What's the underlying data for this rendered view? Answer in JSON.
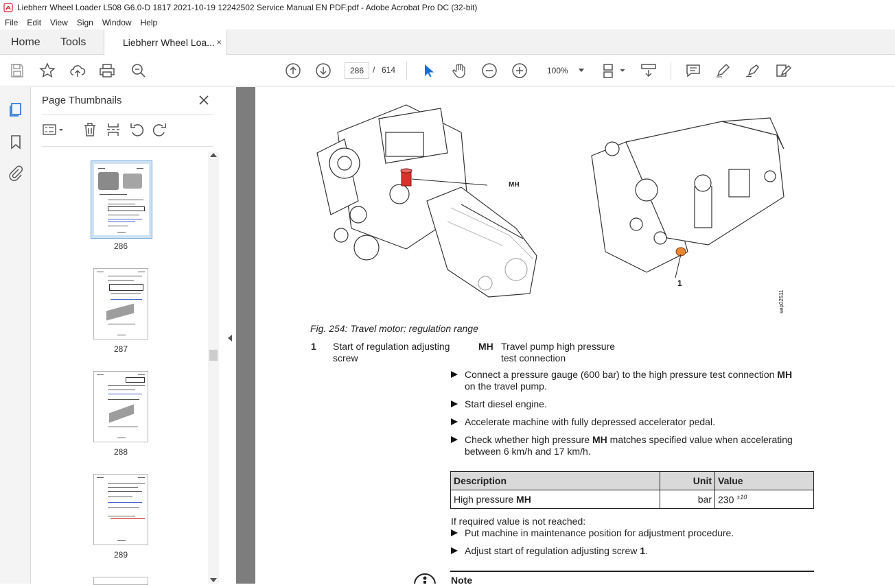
{
  "window": {
    "title": "Liebherr Wheel Loader L508 G6.0-D 1817 2021-10-19 12242502 Service Manual EN PDF.pdf - Adobe Acrobat Pro DC (32-bit)"
  },
  "menu": [
    "File",
    "Edit",
    "View",
    "Sign",
    "Window",
    "Help"
  ],
  "tabs": {
    "home": "Home",
    "tools": "Tools",
    "document": "Liebherr Wheel Loa...",
    "close": "×"
  },
  "toolbar": {
    "current_page": "286",
    "page_separator": "/",
    "page_count": "614",
    "zoom": "100%"
  },
  "thumbnails": {
    "title": "Page Thumbnails",
    "pages": [
      "286",
      "287",
      "288",
      "289"
    ],
    "selected_page": "286"
  },
  "document": {
    "callout_mh": "MH",
    "callout_1": "1",
    "figure_code": "sep02511",
    "caption": "Fig. 254: Travel motor: regulation range",
    "legend": [
      {
        "key": "1",
        "text_line1": "Start of regulation adjusting",
        "text_line2": "screw"
      },
      {
        "key": "MH",
        "text_line1": "Travel pump high pressure",
        "text_line2": "test connection"
      }
    ],
    "steps": {
      "s1_a": "Connect a pressure gauge (600 bar) to the high pressure test connection ",
      "s1_b": "MH",
      "s1_c": "on the travel pump.",
      "s2": "Start diesel engine.",
      "s3": "Accelerate machine with fully depressed accelerator pedal.",
      "s4_a": "Check whether high pressure ",
      "s4_b": "MH",
      "s4_c": " matches specified value when accelerating",
      "s4_d": "between 6 km/h and 17 km/h."
    },
    "table": {
      "headers": [
        "Description",
        "Unit",
        "Value"
      ],
      "row": {
        "desc_a": "High pressure ",
        "desc_b": "MH",
        "unit": "bar",
        "value": "230",
        "tolerance": "±10"
      }
    },
    "if_not_reached": "If required value is not reached:",
    "steps2": {
      "s5": "Put machine in maintenance position for adjustment procedure.",
      "s6_a": "Adjust start of regulation adjusting screw ",
      "s6_b": "1",
      "s6_c": "."
    },
    "note": "Note"
  }
}
